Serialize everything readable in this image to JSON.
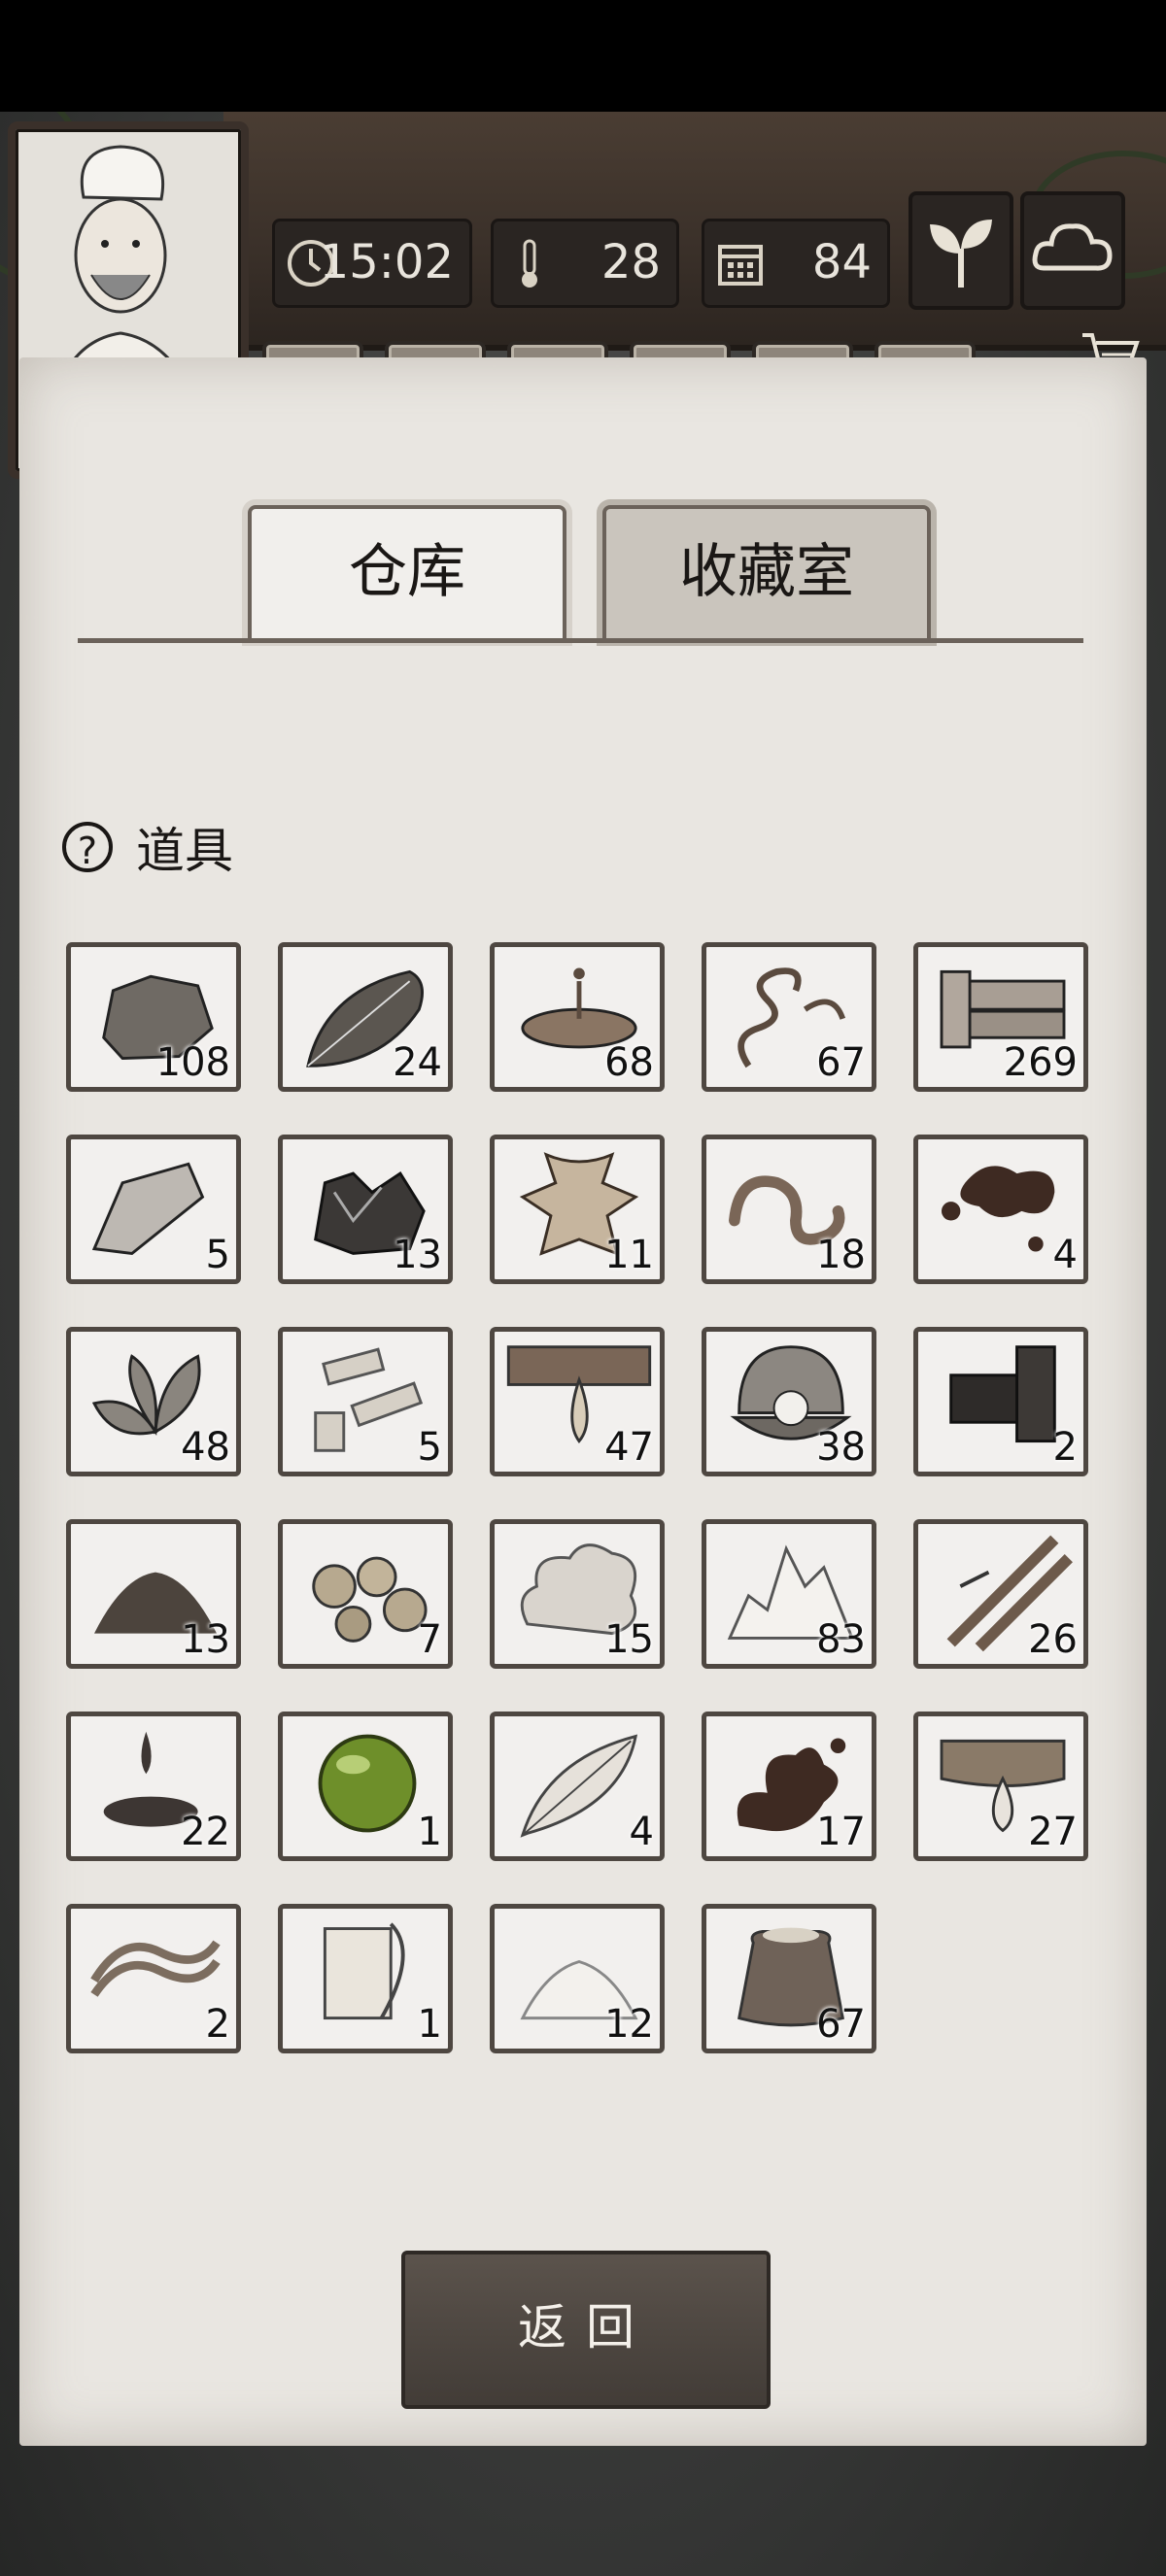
{
  "hud": {
    "time": "15:02",
    "temperature": "28",
    "day": "84"
  },
  "tabs": [
    {
      "label": "仓库",
      "active": true
    },
    {
      "label": "收藏室",
      "active": false
    }
  ],
  "section": {
    "title": "道具",
    "help_symbol": "?"
  },
  "items": [
    {
      "icon": "stone",
      "count": "108"
    },
    {
      "icon": "leaf",
      "count": "24"
    },
    {
      "icon": "water-puddle",
      "count": "68"
    },
    {
      "icon": "vine-sprout",
      "count": "67"
    },
    {
      "icon": "wood-planks",
      "count": "269"
    },
    {
      "icon": "flint",
      "count": "5"
    },
    {
      "icon": "ore-crystals",
      "count": "13"
    },
    {
      "icon": "animal-hide",
      "count": "11"
    },
    {
      "icon": "worm",
      "count": "18"
    },
    {
      "icon": "dark-liquid",
      "count": "4"
    },
    {
      "icon": "herb-leaves",
      "count": "48"
    },
    {
      "icon": "bark-pieces",
      "count": "5"
    },
    {
      "icon": "tree-resin",
      "count": "47"
    },
    {
      "icon": "pearl-shell",
      "count": "38"
    },
    {
      "icon": "charcoal",
      "count": "2"
    },
    {
      "icon": "soil-pile",
      "count": "13"
    },
    {
      "icon": "gold-nuggets",
      "count": "7"
    },
    {
      "icon": "cotton",
      "count": "15"
    },
    {
      "icon": "salt-crystals",
      "count": "83"
    },
    {
      "icon": "bamboo",
      "count": "26"
    },
    {
      "icon": "oil-drop",
      "count": "22"
    },
    {
      "icon": "green-orb",
      "count": "1"
    },
    {
      "icon": "feather",
      "count": "4"
    },
    {
      "icon": "mud-splash",
      "count": "17"
    },
    {
      "icon": "fish-oil",
      "count": "27"
    },
    {
      "icon": "rope",
      "count": "2"
    },
    {
      "icon": "scroll-quill",
      "count": "1"
    },
    {
      "icon": "powder-pile",
      "count": "12"
    },
    {
      "icon": "grain-sack",
      "count": "67"
    }
  ],
  "back_button": "返回",
  "colors": {
    "paper": "#e9e6e1",
    "frame": "#4e4741",
    "heart": "#b32a2a"
  }
}
